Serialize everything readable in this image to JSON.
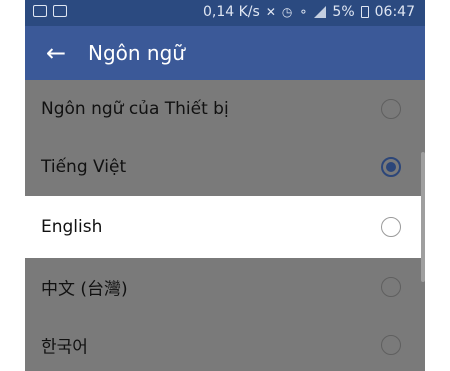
{
  "status_bar": {
    "network_speed": "0,14 K/s",
    "battery_percent": "5%",
    "time": "06:47",
    "icons": [
      "notification-icon",
      "message-icon",
      "mute-icon",
      "alarm-icon",
      "wifi-icon",
      "signal-icon",
      "battery-icon"
    ]
  },
  "app_bar": {
    "back_icon": "arrow-left",
    "title": "Ngôn ngữ"
  },
  "languages": [
    {
      "label": "Ngôn ngữ của Thiết bị",
      "selected": false
    },
    {
      "label": "Tiếng Việt",
      "selected": true
    },
    {
      "label": "English",
      "selected": false
    },
    {
      "label": "中文 (台灣)",
      "selected": false
    },
    {
      "label": "한국어",
      "selected": false
    }
  ],
  "colors": {
    "app_bar": "#3b5998",
    "status_bar": "#2b4a80",
    "dim_overlay": "#7a7a7a",
    "highlight_row": "#ffffff",
    "radio_selected": "#2c4679"
  }
}
